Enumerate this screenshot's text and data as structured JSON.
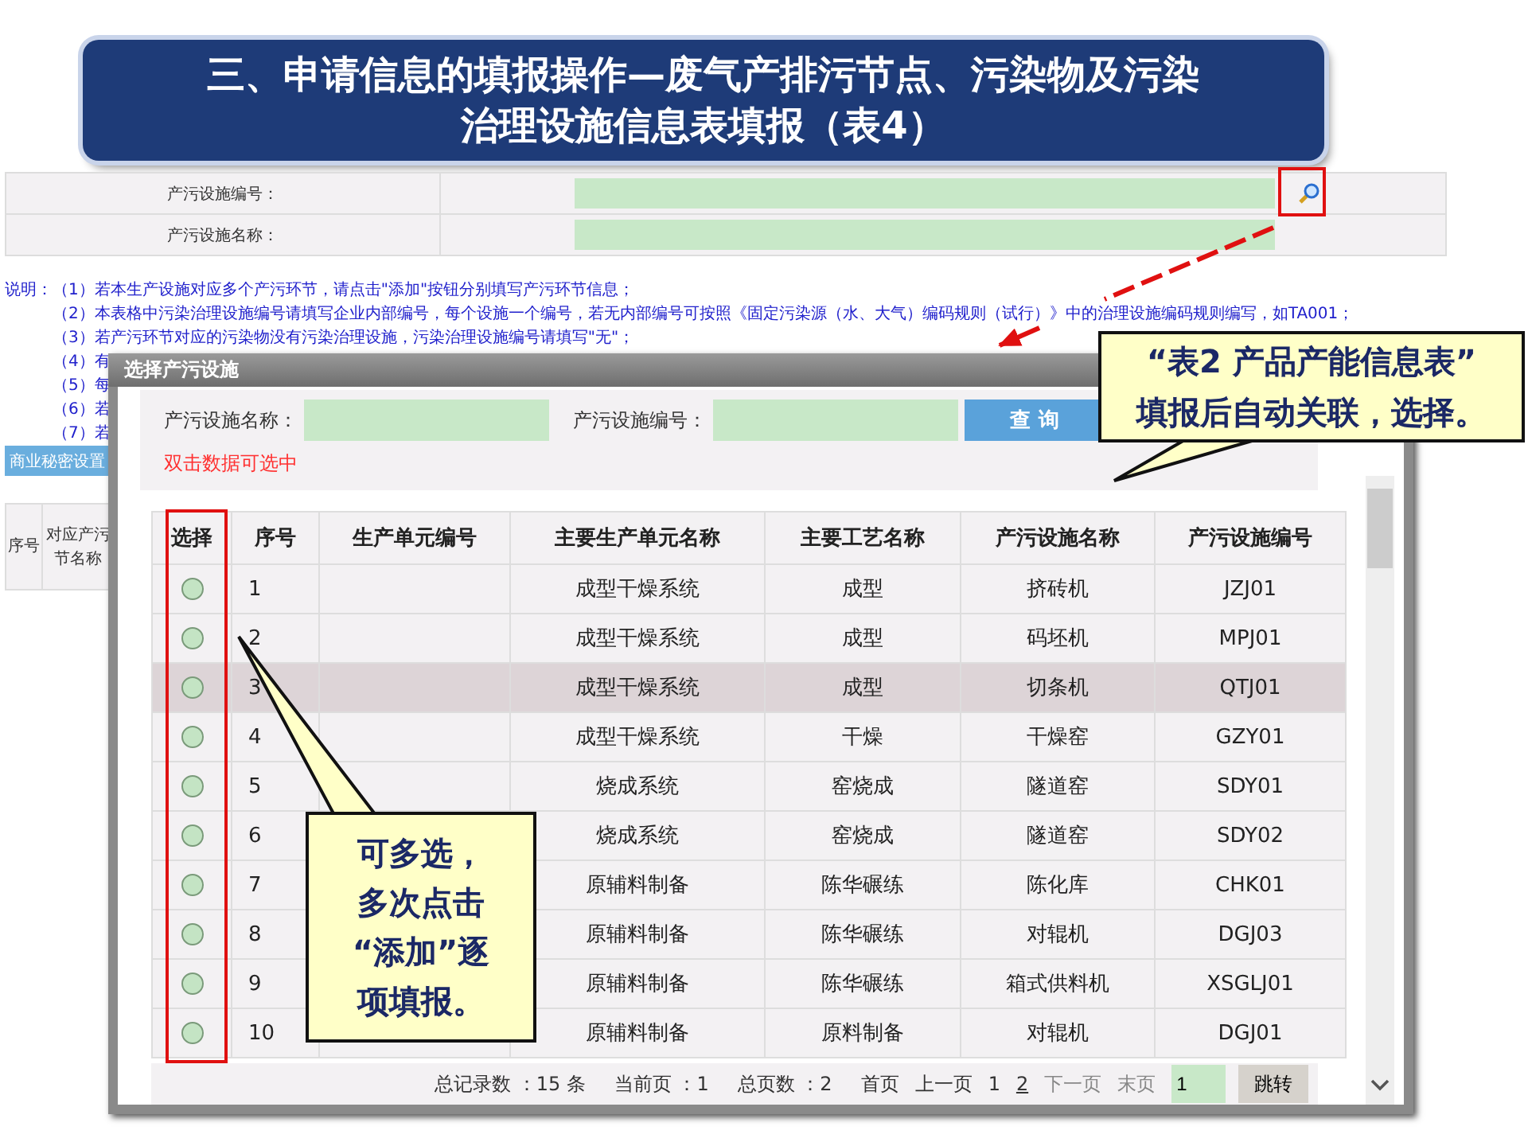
{
  "title": {
    "lines": [
      "三、申请信息的填报操作—废气产排污节点、污染物及污染",
      "治理设施信息表填报（表4）"
    ]
  },
  "form": {
    "fields": [
      {
        "label": "产污设施编号：",
        "lookup": true
      },
      {
        "label": "产污设施名称：",
        "lookup": false
      }
    ]
  },
  "notes": {
    "heading": "说明：",
    "items": [
      "（1）若本生产设施对应多个产污环节，请点击\"添加\"按钮分别填写产污环节信息；",
      "（2）本表格中污染治理设施编号请填写企业内部编号，每个设施一个编号，若无内部编号可按照《固定污染源（水、大气）编码规则（试行）》中的治理设施编码规则编写，如TA001；",
      "（3）若产污环节对应的污染物没有污染治理设施，污染治理设施编号请填写\"无\"；",
      "（4）有",
      "（5）每",
      "（6）若",
      "（7）若"
    ]
  },
  "secret_button": "商业秘密设置",
  "main_table": {
    "columns": [
      {
        "lines": [
          "序号"
        ]
      },
      {
        "lines": [
          "对应产污",
          "节名称"
        ]
      }
    ]
  },
  "dialog": {
    "title": "选择产污设施",
    "filters": [
      {
        "label": "产污设施名称："
      },
      {
        "label": "产污设施编号："
      }
    ],
    "query_button": "查 询",
    "hint": "双击数据可选中",
    "table": {
      "columns": [
        "选择",
        "序号",
        "生产单元编号",
        "主要生产单元名称",
        "主要工艺名称",
        "产污设施名称",
        "产污设施编号"
      ],
      "rows": [
        {
          "no": "1",
          "unit_name": "成型干燥系统",
          "process": "成型",
          "facility": "挤砖机",
          "code": "JZJ01",
          "selected": false
        },
        {
          "no": "2",
          "unit_name": "成型干燥系统",
          "process": "成型",
          "facility": "码坯机",
          "code": "MPJ01",
          "selected": false
        },
        {
          "no": "3",
          "unit_name": "成型干燥系统",
          "process": "成型",
          "facility": "切条机",
          "code": "QTJ01",
          "selected": true
        },
        {
          "no": "4",
          "unit_name": "成型干燥系统",
          "process": "干燥",
          "facility": "干燥窑",
          "code": "GZY01",
          "selected": false
        },
        {
          "no": "5",
          "unit_name": "烧成系统",
          "process": "窑烧成",
          "facility": "隧道窑",
          "code": "SDY01",
          "selected": false
        },
        {
          "no": "6",
          "unit_name": "烧成系统",
          "process": "窑烧成",
          "facility": "隧道窑",
          "code": "SDY02",
          "selected": false
        },
        {
          "no": "7",
          "unit_name": "原辅料制备",
          "process": "陈华碾练",
          "facility": "陈化库",
          "code": "CHK01",
          "selected": false
        },
        {
          "no": "8",
          "unit_name": "原辅料制备",
          "process": "陈华碾练",
          "facility": "对辊机",
          "code": "DGJ03",
          "selected": false
        },
        {
          "no": "9",
          "unit_name": "原辅料制备",
          "process": "陈华碾练",
          "facility": "箱式供料机",
          "code": "XSGLJ01",
          "selected": false
        },
        {
          "no": "10",
          "unit_name": "原辅料制备",
          "process": "原料制备",
          "facility": "对辊机",
          "code": "DGJ01",
          "selected": false
        }
      ]
    },
    "pager": {
      "stats": [
        "总记录数 ：15 条",
        "当前页 ：1",
        "总页数 ：2"
      ],
      "links": [
        {
          "label": "首页",
          "kind": "nav",
          "disabled": false
        },
        {
          "label": "上一页",
          "kind": "nav",
          "disabled": false
        },
        {
          "label": "1",
          "kind": "page",
          "selected": true
        },
        {
          "label": "2",
          "kind": "page",
          "selected": false
        },
        {
          "label": "下一页",
          "kind": "nav",
          "disabled": true
        },
        {
          "label": "末页",
          "kind": "nav",
          "disabled": true
        }
      ],
      "jump_value": "1",
      "jump_button": "跳转"
    }
  },
  "callouts": [
    {
      "lines": [
        "“表2  产品产能信息表”",
        "填报后自动关联，选择。"
      ]
    },
    {
      "lines": [
        "可多选，",
        "多次点击",
        "“添加”逐",
        "项填报。"
      ]
    }
  ]
}
